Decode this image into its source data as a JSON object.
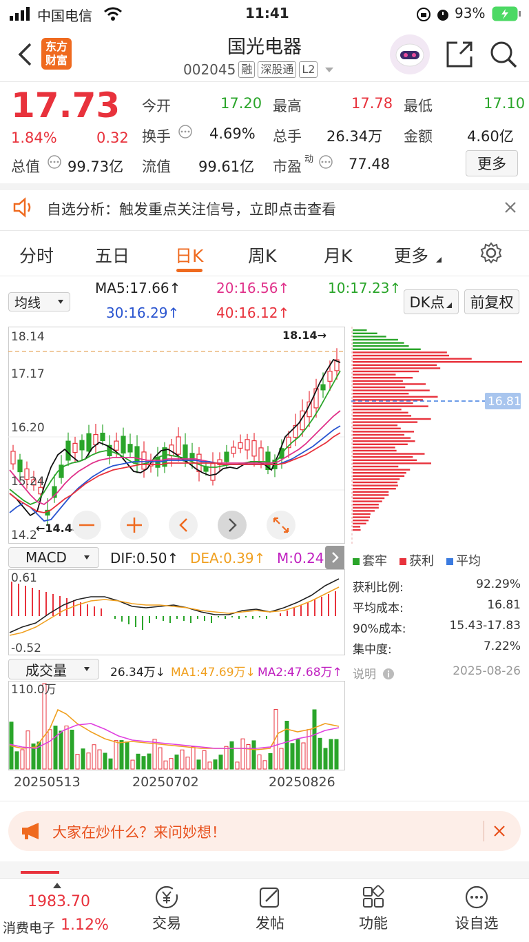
{
  "status_bar": {
    "carrier": "中国电信",
    "time": "11:41",
    "battery": "93%"
  },
  "header": {
    "back_icon": "chevron-left-icon",
    "logo_line1": "东方",
    "logo_line2": "财富",
    "stock_name": "国光电器",
    "stock_code": "002045",
    "tags": [
      "融",
      "深股通",
      "L2"
    ]
  },
  "quote": {
    "price": "17.73",
    "change_pct": "1.84%",
    "change": "0.32",
    "open_label": "今开",
    "open": "17.20",
    "high_label": "最高",
    "high": "17.78",
    "low_label": "最低",
    "low": "17.10",
    "turnover_label": "换手",
    "turnover": "4.69%",
    "volume_label": "总手",
    "volume": "26.34万",
    "amount_label": "金额",
    "amount": "4.60亿",
    "mktcap_label": "总值",
    "mktcap": "99.73亿",
    "float_label": "流值",
    "float_cap": "99.61亿",
    "pe_label": "市盈",
    "pe_sup": "动",
    "pe": "77.48",
    "more_label": "更多"
  },
  "alert": {
    "text": "自选分析：触发重点关注信号，立即点击查看"
  },
  "tabs": [
    "分时",
    "五日",
    "日K",
    "周K",
    "月K",
    "更多"
  ],
  "active_tab": "日K",
  "ma_bar": {
    "selector": "均线",
    "ma5": "MA5:17.66↑",
    "ma20": "20:16.56↑",
    "ma10": "10:17.23↑",
    "ma30": "30:16.29↑",
    "ma40": "40:16.12↑",
    "dk_label": "DK点",
    "fq_label": "前复权"
  },
  "kline": {
    "y_labels": [
      "18.14",
      "17.17",
      "16.20",
      "15.24",
      "14.2"
    ],
    "max_label": "18.14→",
    "min_label": "←14.44",
    "cost_marker": "16.81"
  },
  "macd": {
    "selector": "MACD",
    "dif": "DIF:0.50↑",
    "dea": "DEA:0.39↑",
    "m": "M:0.24↑",
    "top": "0.61",
    "bottom": "-0.52"
  },
  "volume_panel": {
    "selector": "成交量",
    "value": "26.34万↓",
    "ma1": "MA1:47.69万↓",
    "ma2": "MA2:47.68万↑",
    "top": "110.0万",
    "dates": [
      "20250513",
      "20250702",
      "20250826"
    ]
  },
  "distribution": {
    "legend": [
      "套牢",
      "获利",
      "平均"
    ],
    "rows": [
      {
        "label": "获利比例:",
        "value": "92.29%"
      },
      {
        "label": "平均成本:",
        "value": "16.81"
      },
      {
        "label": "90%成本:",
        "value": "15.43-17.83"
      },
      {
        "label": "集中度:",
        "value": "7.22%"
      }
    ],
    "note_label": "说明",
    "date": "2025-08-26"
  },
  "banner": {
    "text": "大家在炒什么？来问妙想！"
  },
  "bottom_nav": {
    "index_value": "1983.70",
    "index_name": "消费电子",
    "index_change": "1.12%",
    "items": [
      "交易",
      "发帖",
      "功能",
      "设自选"
    ]
  }
}
